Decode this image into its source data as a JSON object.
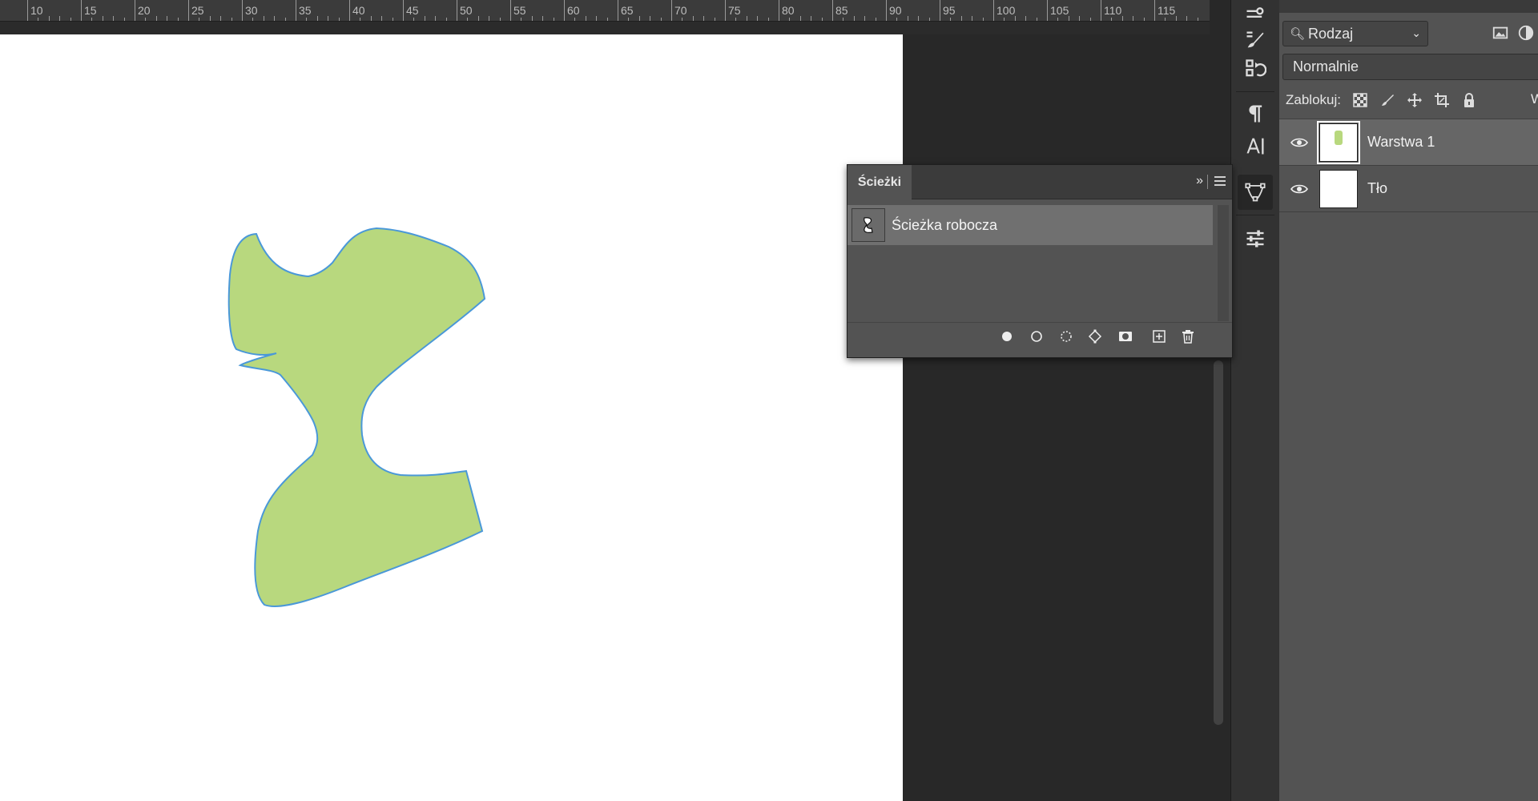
{
  "ruler": {
    "numbers": [
      "10",
      "15",
      "20",
      "25",
      "30",
      "35",
      "40",
      "45",
      "50",
      "55",
      "60",
      "65",
      "70",
      "75",
      "80",
      "85",
      "90",
      "95",
      "100",
      "105",
      "110",
      "115"
    ]
  },
  "canvas": {
    "shape_fill": "#b8d87e",
    "shape_stroke": "#4a98d8"
  },
  "dock": {
    "icons": [
      "properties-icon",
      "brush-icon",
      "history-icon",
      "paragraph-icon",
      "character-icon",
      "paths-icon",
      "adjustments-icon"
    ]
  },
  "layers_panel": {
    "kind_filter": "Rodzaj",
    "blend_mode": "Normalnie",
    "lock_label": "Zablokuj:",
    "lock_right_truncated": "W",
    "layers": [
      {
        "name": "Warstwa 1",
        "selected": true,
        "visible": true
      },
      {
        "name": "Tło",
        "selected": false,
        "visible": true
      }
    ]
  },
  "paths_panel": {
    "title": "Ścieżki",
    "collapse_glyph": "»",
    "paths": [
      {
        "name": "Ścieżka robocza",
        "selected": true
      }
    ],
    "footer_icons": [
      "fill-path-icon",
      "stroke-path-icon",
      "load-as-selection-icon",
      "make-work-path-icon",
      "add-mask-icon",
      "new-path-icon",
      "delete-path-icon"
    ]
  },
  "colors": {
    "ui_dark": "#282828",
    "panel": "#535353",
    "selected_row": "#707070"
  }
}
